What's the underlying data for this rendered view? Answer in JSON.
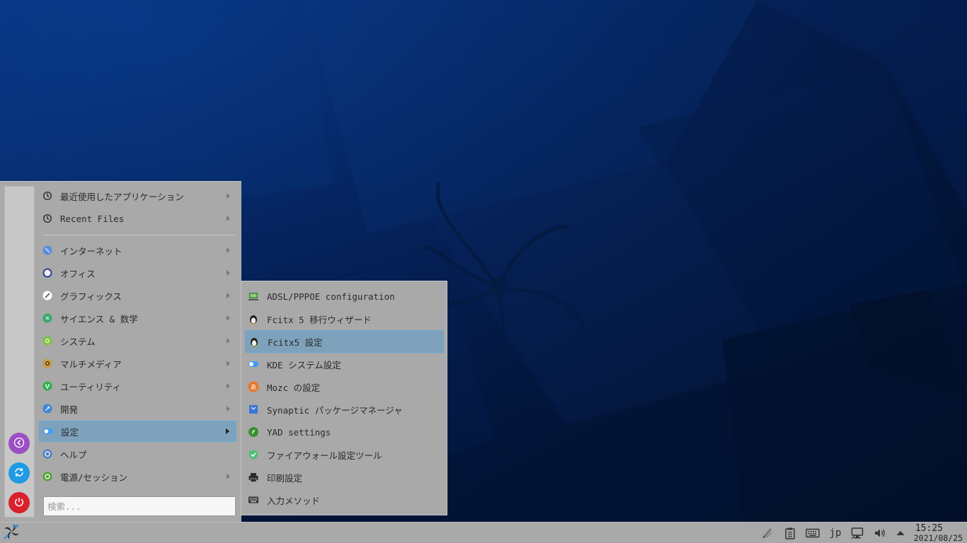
{
  "menu": {
    "categories": [
      {
        "label": "最近使用したアプリケーション",
        "icon": "clock-icon"
      },
      {
        "label": "Recent Files",
        "icon": "clock-icon"
      },
      {
        "label": "インターネット",
        "icon": "internet-icon"
      },
      {
        "label": "オフィス",
        "icon": "office-icon"
      },
      {
        "label": "グラフィックス",
        "icon": "graphics-icon"
      },
      {
        "label": "サイエンス & 数学",
        "icon": "science-icon"
      },
      {
        "label": "システム",
        "icon": "system-icon"
      },
      {
        "label": "マルチメディア",
        "icon": "multimedia-icon"
      },
      {
        "label": "ユーティリティ",
        "icon": "utility-icon"
      },
      {
        "label": "開発",
        "icon": "development-icon"
      },
      {
        "label": "設定",
        "icon": "settings-toggle-icon"
      },
      {
        "label": "ヘルプ",
        "icon": "help-icon"
      },
      {
        "label": "電源/セッション",
        "icon": "power-session-icon"
      }
    ],
    "active_category": "設定",
    "search": {
      "placeholder": "検索..."
    },
    "side_buttons": [
      "back-icon",
      "refresh-icon",
      "power-icon"
    ]
  },
  "submenu": {
    "items": [
      {
        "label": "ADSL/PPPOE configuration",
        "icon": "network-config-icon"
      },
      {
        "label": "Fcitx 5 移行ウィザード",
        "icon": "tux-icon"
      },
      {
        "label": "Fcitx5 設定",
        "icon": "tux-icon"
      },
      {
        "label": "KDE システム設定",
        "icon": "kde-settings-icon"
      },
      {
        "label": "Mozc の設定",
        "icon": "mozc-icon"
      },
      {
        "label": "Synaptic パッケージマネージャ",
        "icon": "synaptic-icon"
      },
      {
        "label": "YAD settings",
        "icon": "yad-icon"
      },
      {
        "label": "ファイアウォール設定ツール",
        "icon": "firewall-icon"
      },
      {
        "label": "印刷設定",
        "icon": "printer-icon"
      },
      {
        "label": "入力メソッド",
        "icon": "keyboard-icon"
      }
    ],
    "active_item": "Fcitx5 設定"
  },
  "taskbar": {
    "start_icon": "distro-logo-icon",
    "tray": {
      "keyboard_layout": "jp",
      "icons": [
        "clipboard-pen-icon",
        "clipboard-icon",
        "keyboard-icon",
        "network-icon",
        "volume-icon",
        "tray-expand-icon"
      ]
    },
    "clock": {
      "time": "15:25",
      "date": "2021/08/25"
    }
  },
  "colors": {
    "desktop_bg": "#07255a",
    "panel_bg": "#a9a9a9",
    "highlight": "#7fa2bc",
    "highlight_border": "#64a9d9"
  }
}
